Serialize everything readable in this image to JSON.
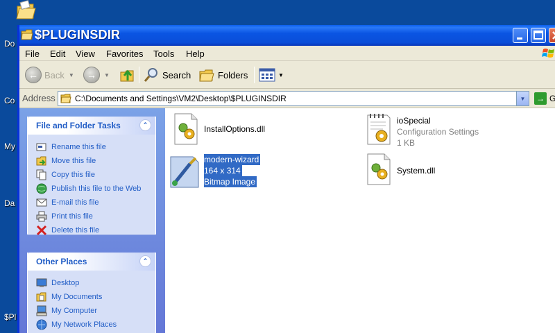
{
  "desktop": {
    "labels": [
      "Do",
      "Co",
      "My",
      "Da",
      "$Pl"
    ]
  },
  "window": {
    "title": "$PLUGINSDIR"
  },
  "menu": [
    "File",
    "Edit",
    "View",
    "Favorites",
    "Tools",
    "Help"
  ],
  "toolbar": {
    "back": "Back",
    "search": "Search",
    "folders": "Folders"
  },
  "address": {
    "label": "Address",
    "value": "C:\\Documents and Settings\\VM2\\Desktop\\$PLUGINSDIR",
    "go": "Go"
  },
  "file_tasks": {
    "title": "File and Folder Tasks",
    "items": [
      "Rename this file",
      "Move this file",
      "Copy this file",
      "Publish this file to the Web",
      "E-mail this file",
      "Print this file",
      "Delete this file"
    ]
  },
  "other_places": {
    "title": "Other Places",
    "items": [
      "Desktop",
      "My Documents",
      "My Computer",
      "My Network Places"
    ]
  },
  "files": [
    {
      "name": "InstallOptions.dll",
      "sub1": "",
      "sub2": ""
    },
    {
      "name": "ioSpecial",
      "sub1": "Configuration Settings",
      "sub2": "1 KB"
    },
    {
      "name": "modern-wizard",
      "sub1": "164 x 314",
      "sub2": "Bitmap Image"
    },
    {
      "name": "System.dll",
      "sub1": "",
      "sub2": ""
    }
  ],
  "colors": {
    "titlebar": "#0a55e3",
    "task_link": "#215dc6",
    "selection": "#316ac5"
  }
}
